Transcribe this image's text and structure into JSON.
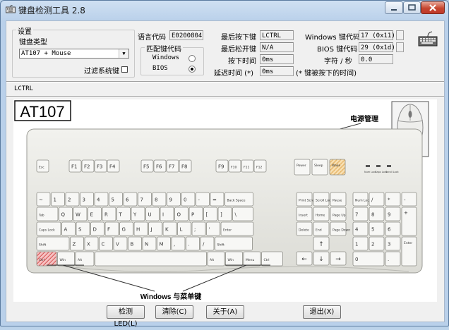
{
  "window": {
    "title": "键盘检测工具 2.8"
  },
  "settings": {
    "group_title": "设置",
    "keyboard_type_label": "键盘类型",
    "keyboard_type_value": "AT107 + Mouse",
    "filter_system_keys_label": "过滤系统键",
    "filter_system_keys_checked": false
  },
  "language": {
    "label": "语言代码",
    "value": "E0200804"
  },
  "match_code": {
    "group_title": "匹配键代码",
    "options": [
      {
        "label": "Windows",
        "selected": false
      },
      {
        "label": "BIOS",
        "selected": true
      }
    ]
  },
  "info": {
    "last_pressed_label": "最后按下键",
    "last_pressed_value": "LCTRL",
    "last_released_label": "最后松开键",
    "last_released_value": "N/A",
    "press_time_label": "按下时间",
    "press_time_value": "0ms",
    "delay_time_label": "延迟时间 (*)",
    "delay_time_value": "0ms",
    "delay_note": "(* 键被按下的时间)",
    "windows_code_label": "Windows 键代码",
    "windows_code_value": "17 (0x11)",
    "bios_code_label": "BIOS 键代码",
    "bios_code_value": "29 (0x1d)",
    "chars_per_sec_label": "字符 / 秒",
    "chars_per_sec_value": "0.0"
  },
  "log_line": "LCTRL",
  "keyboard": {
    "model_label": "AT107",
    "power_annotation": "电源管理",
    "windows_annotation": "Windows 与菜单键",
    "esc": "Esc",
    "f_keys": [
      "F1",
      "F2",
      "F3",
      "F4",
      "F5",
      "F6",
      "F7",
      "F8",
      "F9",
      "F10",
      "F11",
      "F12"
    ],
    "power_keys": [
      "Power",
      "Sleep",
      "Wake"
    ],
    "lock_leds": [
      "Num Lock",
      "Caps Lock",
      "Scroll Lock"
    ],
    "row1": [
      "~",
      "1",
      "2",
      "3",
      "4",
      "5",
      "6",
      "7",
      "8",
      "9",
      "0",
      "-",
      "=",
      "Back Space"
    ],
    "row2": [
      "Tab",
      "Q",
      "W",
      "E",
      "R",
      "T",
      "Y",
      "U",
      "I",
      "O",
      "P",
      "[",
      "]",
      "\\"
    ],
    "row3": [
      "Caps Lock",
      "A",
      "S",
      "D",
      "F",
      "G",
      "H",
      "J",
      "K",
      "L",
      ";",
      "'",
      "Enter"
    ],
    "row4": [
      "Shift",
      "Z",
      "X",
      "C",
      "V",
      "B",
      "N",
      "M",
      ",",
      ".",
      "/",
      "Shift"
    ],
    "row5": [
      "Ctrl",
      "Win",
      "Alt",
      "",
      "Alt",
      "Win",
      "Menu",
      "Ctrl"
    ],
    "nav_top": [
      "Print Screen",
      "Scroll Lock",
      "Pause"
    ],
    "nav_mid1": [
      "Insert",
      "Home",
      "Page Up"
    ],
    "nav_mid2": [
      "Delete",
      "End",
      "Page Down"
    ],
    "numpad_row1": [
      "Num Lock",
      "/",
      "*",
      "-"
    ],
    "numpad_row2": [
      "7",
      "8",
      "9",
      "+"
    ],
    "numpad_row3": [
      "4",
      "5",
      "6"
    ],
    "numpad_row4": [
      "1",
      "2",
      "3",
      "Enter"
    ],
    "numpad_row5": [
      "0",
      "."
    ],
    "pressed_key": "Ctrl"
  },
  "buttons": {
    "detect_led": "检测LED(L)",
    "clear": "清除(C)",
    "about": "关于(A)",
    "exit": "退出(X)"
  },
  "colors": {
    "pressed": "#cc3333",
    "highlight": "#e8b24a",
    "keyboard_body": "#ecece8",
    "key_face": "#f7f7f5"
  }
}
